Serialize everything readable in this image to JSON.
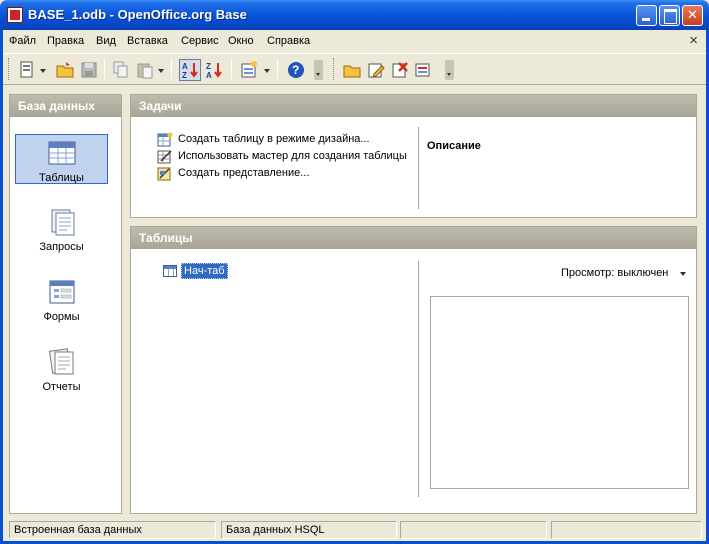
{
  "window": {
    "title": "BASE_1.odb - OpenOffice.org Base"
  },
  "menu": {
    "items": [
      "Файл",
      "Правка",
      "Вид",
      "Вставка",
      "Сервис",
      "Окно",
      "Справка"
    ],
    "close_glyph": "×"
  },
  "toolbar": {
    "icons": [
      "new-document-icon",
      "open-folder-icon",
      "save-icon",
      "copy-icon",
      "paste-icon",
      "sort-ascending-icon",
      "sort-descending-icon",
      "form-wizard-icon",
      "help-icon",
      "open-db-object-icon",
      "edit-icon",
      "delete-icon",
      "rename-icon"
    ]
  },
  "database_panel": {
    "title": "База данных",
    "items": [
      {
        "label": "Таблицы",
        "icon": "tables-icon",
        "selected": true
      },
      {
        "label": "Запросы",
        "icon": "queries-icon",
        "selected": false
      },
      {
        "label": "Формы",
        "icon": "forms-icon",
        "selected": false
      },
      {
        "label": "Отчеты",
        "icon": "reports-icon",
        "selected": false
      }
    ]
  },
  "tasks_panel": {
    "title": "Задачи",
    "tasks": [
      {
        "label": "Создать таблицу в режиме дизайна...",
        "icon": "design-table-icon"
      },
      {
        "label": "Использовать мастер для создания таблицы",
        "icon": "wizard-icon"
      },
      {
        "label": "Создать представление...",
        "icon": "create-view-icon"
      }
    ],
    "description_title": "Описание"
  },
  "tables_panel": {
    "title": "Таблицы",
    "tables": [
      "Нач-таб"
    ],
    "preview_label": "Просмотр: выключен"
  },
  "status": {
    "cells": [
      "Встроенная база данных",
      "База данных HSQL",
      "",
      ""
    ]
  },
  "colors": {
    "titlebar": "#0a55d8",
    "selection": "#316ac5",
    "panel_header": "#a9a597"
  }
}
